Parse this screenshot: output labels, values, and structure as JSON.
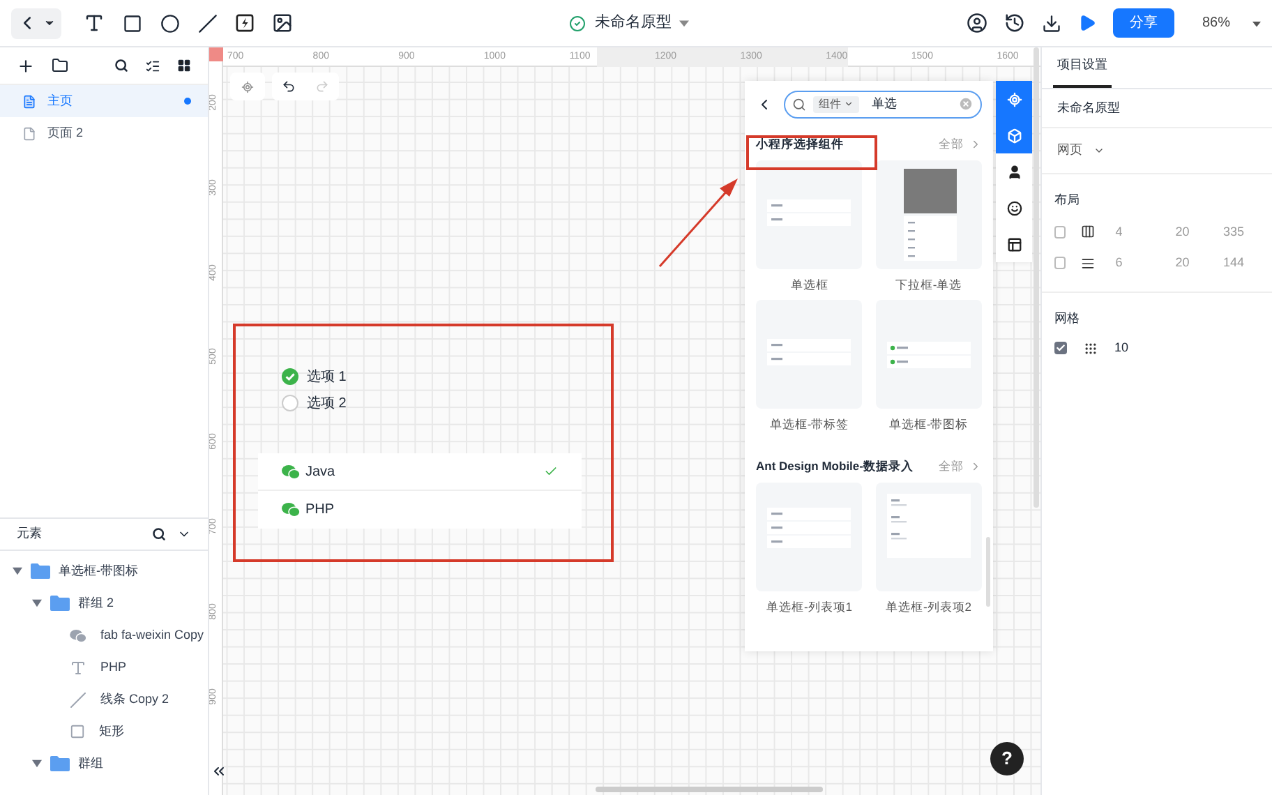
{
  "toolbar": {
    "title": "未命名原型",
    "saved": true,
    "share": "分享",
    "zoom": "86%"
  },
  "pages": [
    {
      "label": "主页",
      "selected": true,
      "modified": true
    },
    {
      "label": "页面 2",
      "selected": false,
      "modified": false
    }
  ],
  "elements": {
    "title": "元素",
    "tree": [
      {
        "label": "单选框-带图标",
        "kind": "folder",
        "expanded": true,
        "children": [
          {
            "label": "群组 2",
            "kind": "folder",
            "expanded": true,
            "children": [
              {
                "label": "fab fa-weixin Copy",
                "kind": "icon"
              },
              {
                "label": "PHP",
                "kind": "text"
              },
              {
                "label": "线条 Copy 2",
                "kind": "line"
              },
              {
                "label": "矩形",
                "kind": "rect"
              }
            ]
          },
          {
            "label": "群组",
            "kind": "folder",
            "expanded": true
          }
        ]
      }
    ]
  },
  "canvas": {
    "x_ruler": [
      "700",
      "800",
      "900",
      "1000",
      "1100",
      "1200",
      "1300",
      "1400",
      "1500",
      "1600"
    ],
    "y_ruler": [
      "200",
      "300",
      "400",
      "500",
      "600",
      "700",
      "800",
      "900"
    ],
    "radios": [
      {
        "label": "选项 1",
        "selected": true
      },
      {
        "label": "选项 2",
        "selected": false
      }
    ],
    "list": [
      {
        "label": "Java",
        "selected": true
      },
      {
        "label": "PHP",
        "selected": false
      }
    ],
    "help": "?"
  },
  "component_panel": {
    "search": {
      "filter": "组件",
      "value": "单选"
    },
    "side_tabs": [
      {
        "kind": "target",
        "selected": true
      },
      {
        "kind": "cube",
        "selected": true
      },
      {
        "kind": "user",
        "selected": false
      },
      {
        "kind": "smile",
        "selected": false
      },
      {
        "kind": "layout",
        "selected": false
      }
    ],
    "sections": [
      {
        "title": "小程序选择组件",
        "more": "全部",
        "items": [
          {
            "label": "单选框",
            "kind": "list"
          },
          {
            "label": "下拉框-单选",
            "kind": "picker"
          },
          {
            "label": "单选框-带标签",
            "kind": "tagged"
          },
          {
            "label": "单选框-带图标",
            "kind": "icons"
          }
        ]
      },
      {
        "title": "Ant Design Mobile-数据录入",
        "more": "全部",
        "items": [
          {
            "label": "单选框-列表项1",
            "kind": "list3"
          },
          {
            "label": "单选框-列表项2",
            "kind": "desc"
          }
        ]
      }
    ]
  },
  "settings": {
    "tab": "项目设置",
    "name": "未命名原型",
    "device": "网页",
    "layout_title": "布局",
    "layout": [
      {
        "kind": "columns",
        "checked": false,
        "values": [
          "4",
          "20",
          "335"
        ]
      },
      {
        "kind": "rows",
        "checked": false,
        "values": [
          "6",
          "20",
          "144"
        ]
      }
    ],
    "grid_title": "网格",
    "grid": {
      "checked": true,
      "value": "10"
    }
  }
}
